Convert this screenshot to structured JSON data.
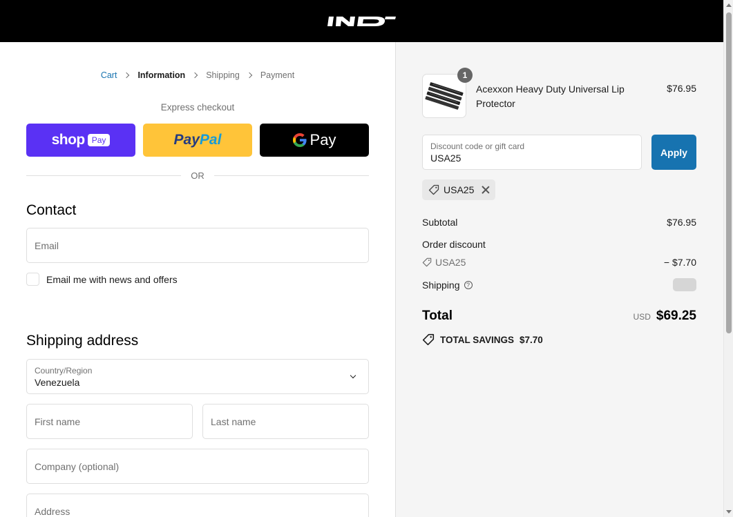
{
  "brand": {
    "logo_text": "IND"
  },
  "breadcrumb": {
    "items": [
      "Cart",
      "Information",
      "Shipping",
      "Payment"
    ]
  },
  "express": {
    "title": "Express checkout",
    "shop_word": "shop",
    "shop_pay": "Pay",
    "paypal_part1": "Pay",
    "paypal_part2": "Pal",
    "gpay_word": "Pay",
    "or_text": "OR"
  },
  "contact": {
    "title": "Contact",
    "email_placeholder": "Email",
    "newsletter_label": "Email me with news and offers"
  },
  "shipping_address": {
    "title": "Shipping address",
    "country_label": "Country/Region",
    "country_value": "Venezuela",
    "first_name_placeholder": "First name",
    "last_name_placeholder": "Last name",
    "company_placeholder": "Company (optional)",
    "address_placeholder": "Address"
  },
  "summary": {
    "product": {
      "name": "Acexxon Heavy Duty Universal Lip Protector",
      "price": "$76.95",
      "quantity": "1"
    },
    "discount": {
      "label": "Discount code or gift card",
      "value": "USA25",
      "apply_label": "Apply",
      "applied_code": "USA25"
    },
    "subtotal_label": "Subtotal",
    "subtotal_value": "$76.95",
    "order_discount_label": "Order discount",
    "order_discount_code": "USA25",
    "order_discount_value": "− $7.70",
    "shipping_label": "Shipping",
    "total_label": "Total",
    "currency": "USD",
    "total_value": "$69.25",
    "savings_label": "TOTAL SAVINGS",
    "savings_value": "$7.70"
  },
  "colors": {
    "accent": "#1773b0",
    "shop_pay": "#5a31f4",
    "paypal": "#ffc439",
    "header": "#000000",
    "summary_bg": "#f5f5f5"
  },
  "icons": [
    "logo",
    "chevron-right-icon",
    "chevron-down-icon",
    "tag-icon",
    "close-icon",
    "help-icon",
    "google-g-icon"
  ]
}
